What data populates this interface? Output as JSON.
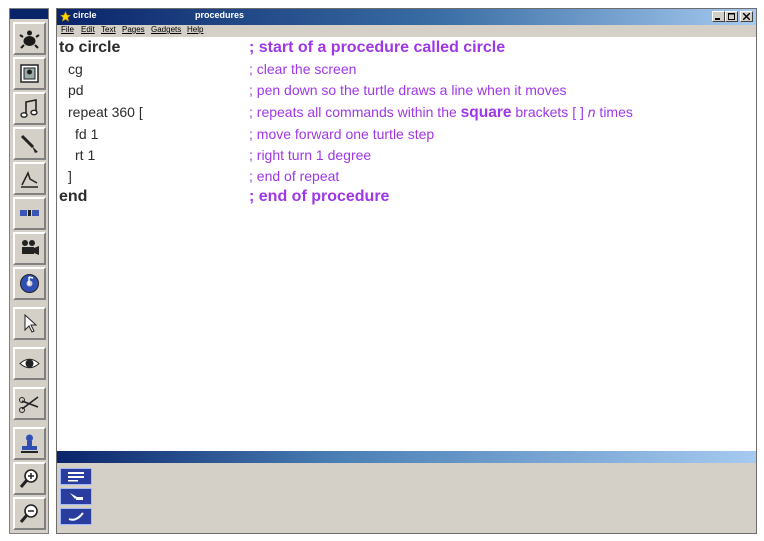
{
  "window": {
    "title_left": "circle",
    "title_right": "procedures"
  },
  "menubar": {
    "items": [
      "File",
      "Edit",
      "Text",
      "Pages",
      "Gadgets",
      "Help"
    ]
  },
  "toolbar": {
    "tools": [
      "turtle-icon",
      "picture-frame-icon",
      "music-note-icon",
      "paint-brush-icon",
      "slider-icon",
      "button-icon",
      "camera-icon",
      "cd-icon",
      "arrow-pointer-icon",
      "eye-icon",
      "scissors-icon",
      "stamp-icon",
      "zoom-in-icon",
      "zoom-out-icon"
    ]
  },
  "editor": {
    "lines": [
      {
        "code": "to circle",
        "comment": "; start of a procedure called circle"
      },
      {
        "code": "cg",
        "comment": "; clear the screen"
      },
      {
        "code": "pd",
        "comment": "; pen down so the turtle draws a line when it moves"
      },
      {
        "code": "repeat 360 [",
        "comment_before": "; repeats all commands within the ",
        "comment_square": "square",
        "comment_after": " brackets [ ] ",
        "comment_n": "n",
        "comment_end": " times"
      },
      {
        "code": "fd 1",
        "comment": "; move forward one turtle step"
      },
      {
        "code": "rt 1",
        "comment": "; right turn 1 degree"
      },
      {
        "code": "]",
        "comment": "; end of repeat"
      },
      {
        "code": "end",
        "comment": "; end of procedure"
      }
    ]
  },
  "lower_panel": {
    "tools": [
      "command-center-icon",
      "tool-icon",
      "brush-icon"
    ]
  },
  "colors": {
    "comment": "#9f37e6",
    "titlebar": "#0a246a",
    "chrome": "#d4d0c8"
  }
}
